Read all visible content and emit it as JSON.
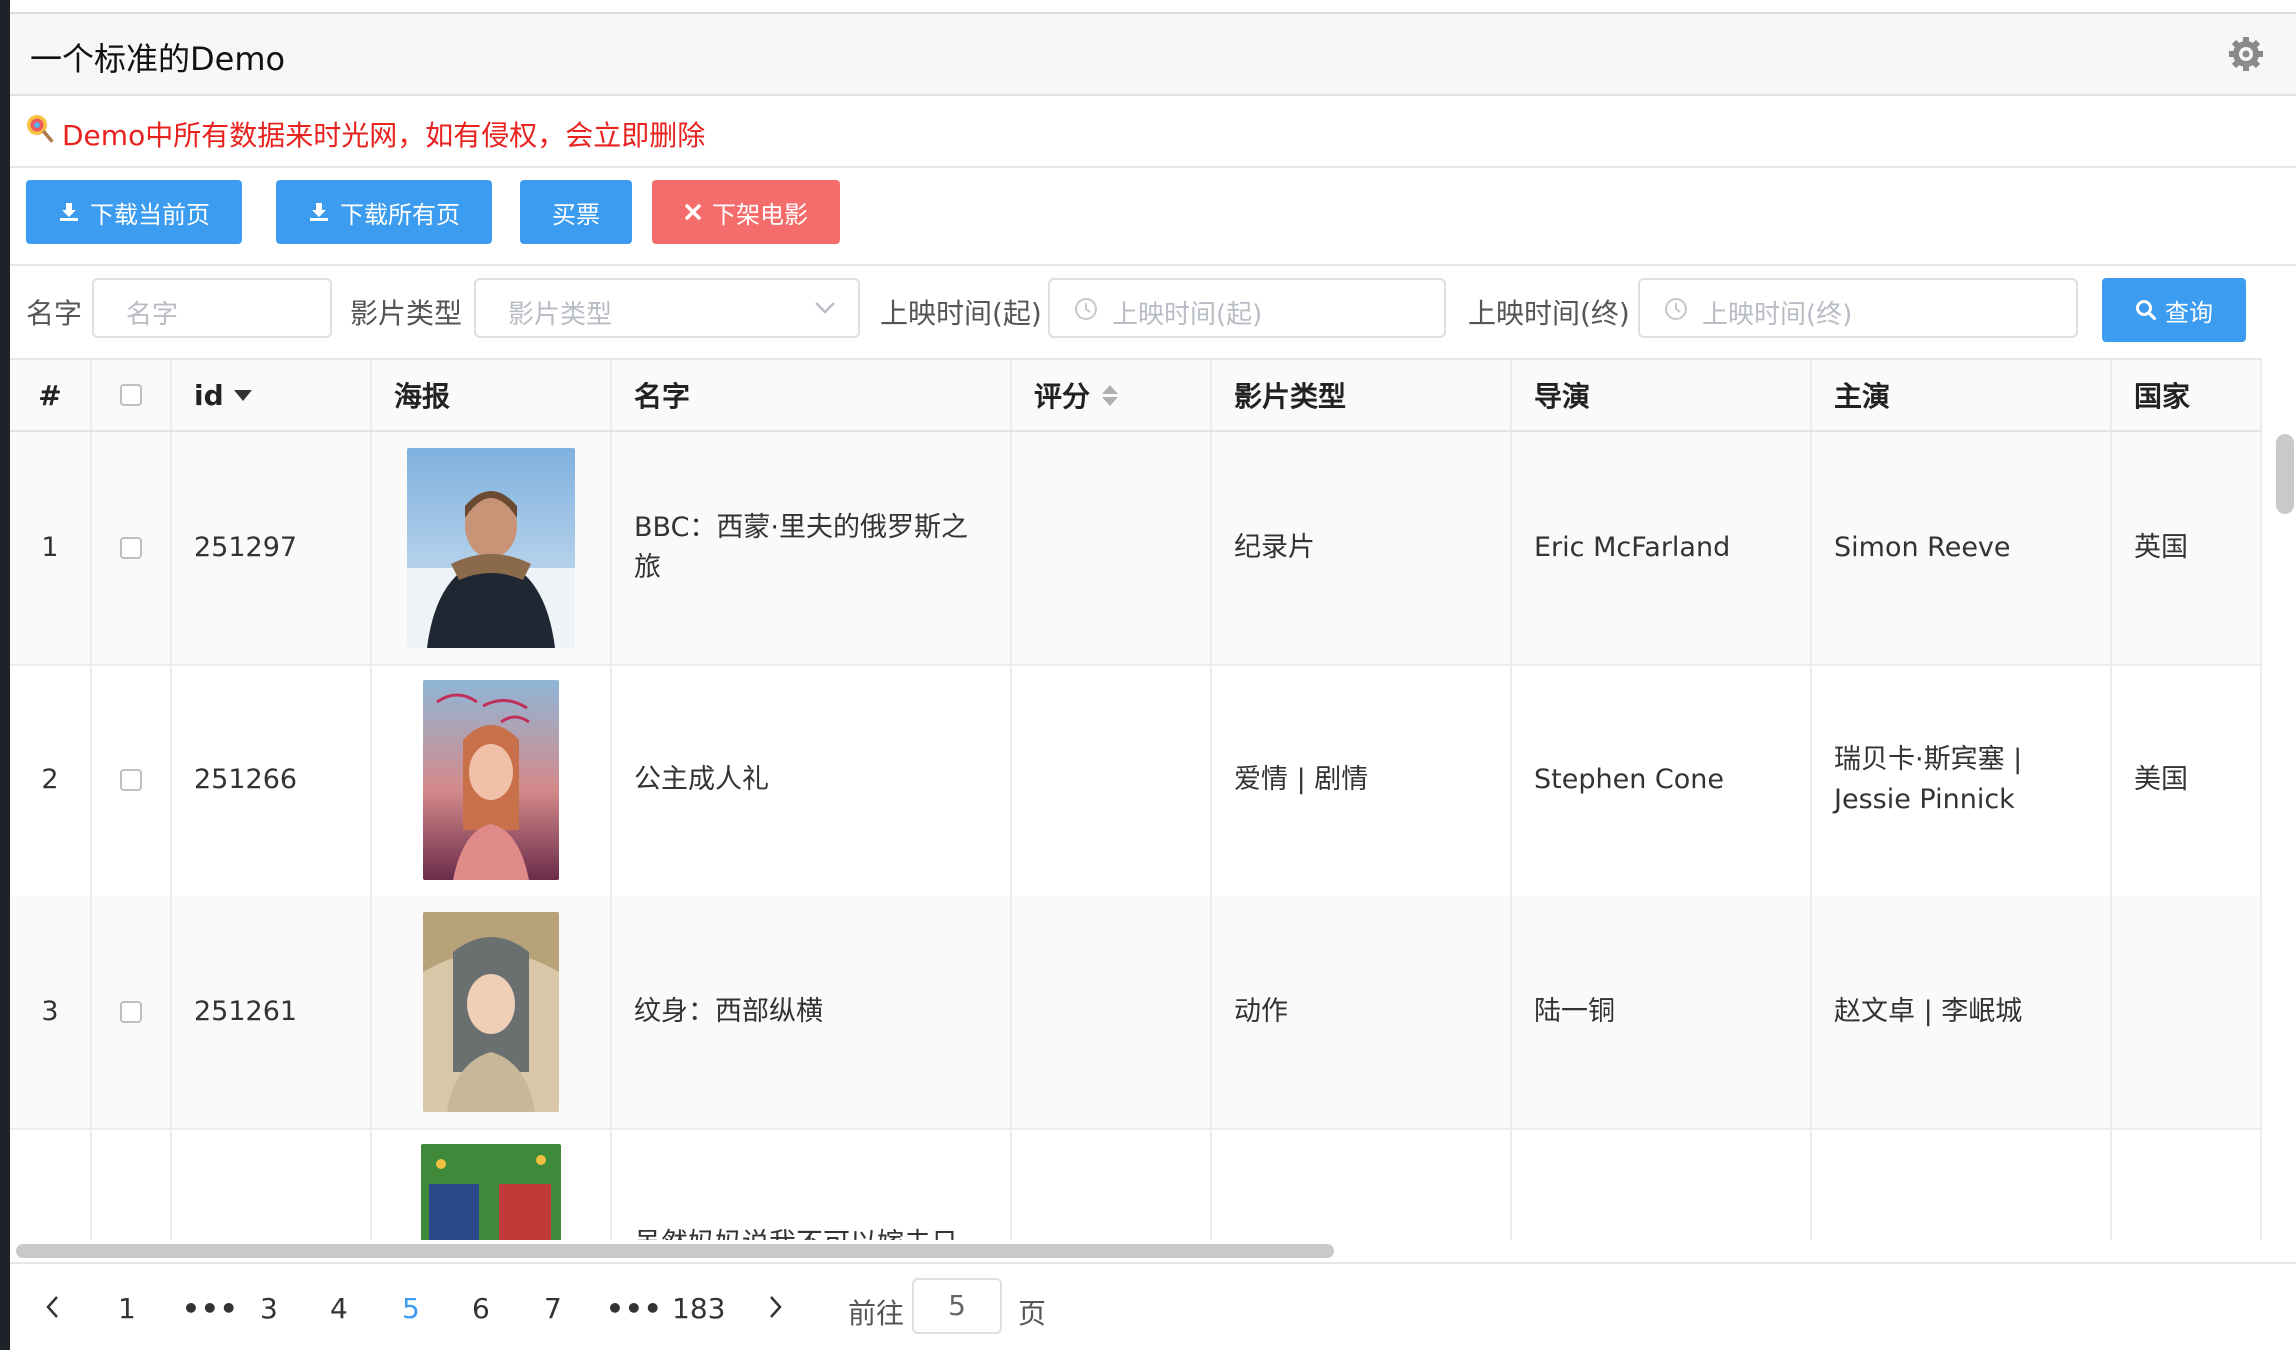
{
  "header": {
    "title": "一个标准的Demo",
    "settings_icon": "gear-icon"
  },
  "notice": {
    "icon": "lollipop-icon",
    "text": "Demo中所有数据来时光网，如有侵权，会立即删除",
    "color": "#e8231f"
  },
  "toolbar": {
    "download_current": "下载当前页",
    "download_all": "下载所有页",
    "buy_ticket": "买票",
    "remove_movie": "下架电影",
    "primary_color": "#3c9cf0",
    "danger_color": "#f56c6c"
  },
  "filters": {
    "name_label": "名字",
    "name_placeholder": "名字",
    "genre_label": "影片类型",
    "genre_placeholder": "影片类型",
    "start_label": "上映时间(起)",
    "start_placeholder": "上映时间(起)",
    "end_label": "上映时间(终)",
    "end_placeholder": "上映时间(终)",
    "query_button": "查询"
  },
  "table": {
    "columns": [
      "#",
      "",
      "id",
      "海报",
      "名字",
      "评分",
      "影片类型",
      "导演",
      "主演",
      "国家"
    ],
    "rows": [
      {
        "index": "1",
        "id": "251297",
        "name": "BBC：西蒙·里夫的俄罗斯之旅",
        "score": "",
        "genre": "纪录片",
        "director": "Eric McFarland",
        "actors": "Simon Reeve",
        "country": "英国"
      },
      {
        "index": "2",
        "id": "251266",
        "name": "公主成人礼",
        "score": "",
        "genre": "爱情 | 剧情",
        "director": "Stephen Cone",
        "actors": "瑞贝卡·斯宾塞 | Jessie Pinnick",
        "country": "美国"
      },
      {
        "index": "3",
        "id": "251261",
        "name": "纹身：西部纵横",
        "score": "",
        "genre": "动作",
        "director": "陆一铜",
        "actors": "赵文卓 | 李岷城",
        "country": ""
      },
      {
        "index": "",
        "id": "",
        "name": "虽然妈妈说我不可以嫁去日",
        "score": "",
        "genre": "",
        "director": "",
        "actors": "",
        "country": ""
      }
    ]
  },
  "pagination": {
    "pages": [
      "1",
      "3",
      "4",
      "5",
      "6",
      "7",
      "183"
    ],
    "current": "5",
    "goto_prefix": "前往",
    "goto_value": "5",
    "goto_suffix": "页"
  }
}
